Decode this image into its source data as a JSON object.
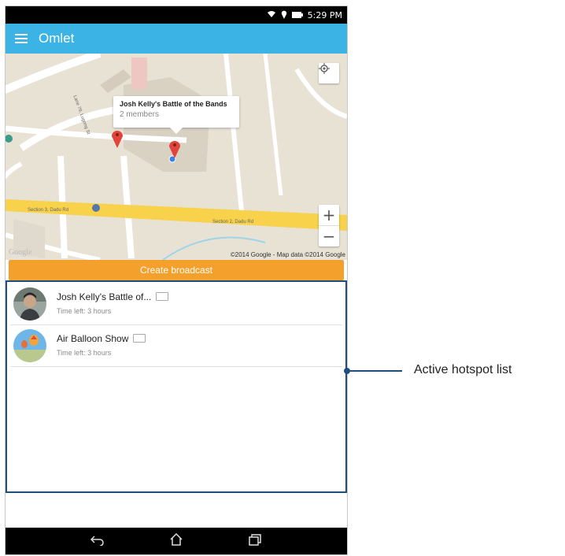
{
  "statusbar": {
    "time": "5:29 PM",
    "wifi_icon": "wifi-icon",
    "location_icon": "location-icon",
    "battery_icon": "battery-icon"
  },
  "appbar": {
    "title": "Omlet",
    "menu_icon": "hamburger-menu-icon"
  },
  "map": {
    "infowindow": {
      "title": "Josh Kelly's Battle of the Bands",
      "subtitle": "2 members"
    },
    "attribution": "©2014 Google - Map data ©2014 Google",
    "logo": "Google",
    "street_labels": [
      "Section 3, Dadu Rd",
      "Section 2, Dadu Rd",
      "Lane 79, Lugong St"
    ],
    "controls": {
      "zoom_in": "+",
      "zoom_out": "−",
      "locate_icon": "my-location-icon"
    }
  },
  "broadcast_button": "Create broadcast",
  "hotspots": [
    {
      "name": "Josh Kelly's Battle of...",
      "time": "Time left: 3 hours"
    },
    {
      "name": "Air Balloon Show",
      "time": "Time left: 3 hours"
    }
  ],
  "callout": {
    "label": "Active hotspot list"
  },
  "navbar": {
    "back_icon": "back-icon",
    "home_icon": "home-icon",
    "recents_icon": "recents-icon"
  },
  "colors": {
    "appbar": "#3cb3e5",
    "broadcast": "#f4a02d",
    "callout": "#1d4f7c"
  }
}
